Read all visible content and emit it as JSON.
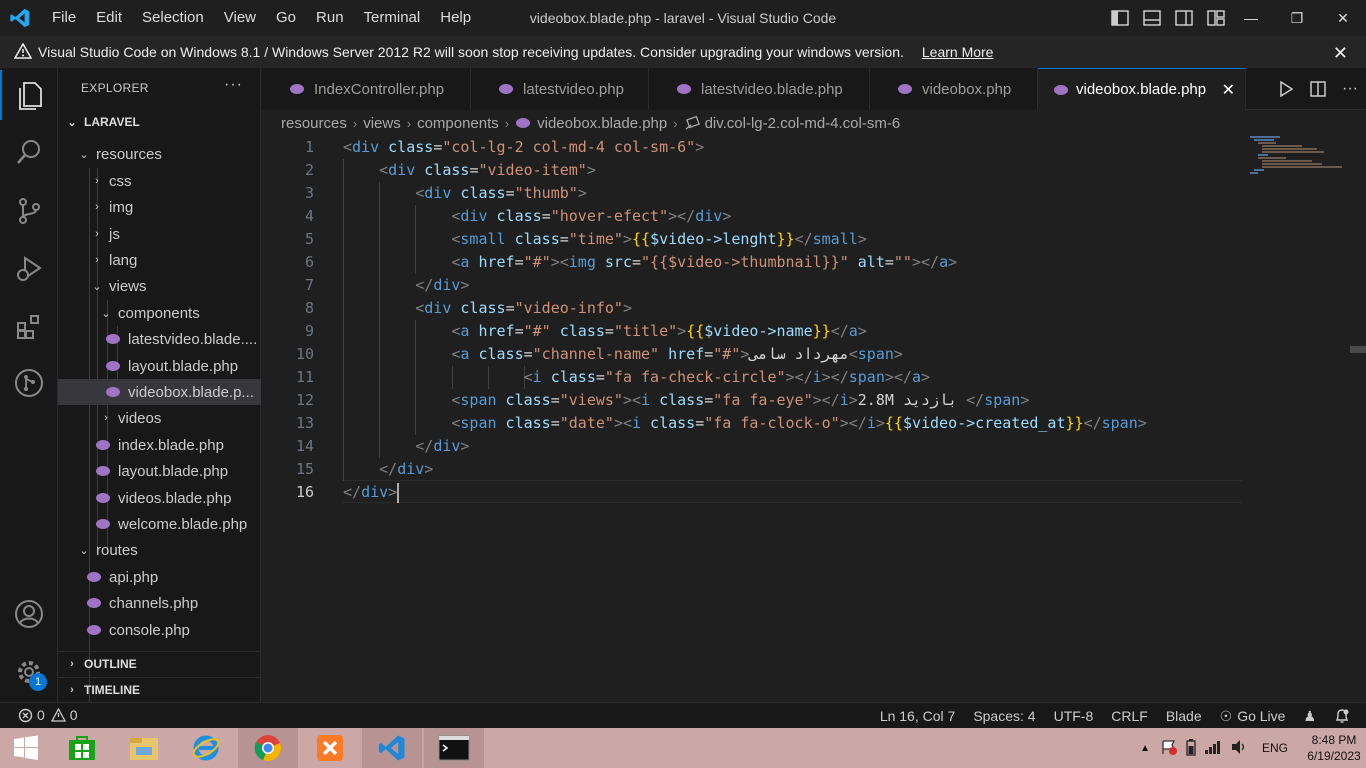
{
  "titlebar": {
    "menu": [
      "File",
      "Edit",
      "Selection",
      "View",
      "Go",
      "Run",
      "Terminal",
      "Help"
    ],
    "title": "videobox.blade.php - laravel - Visual Studio Code"
  },
  "banner": {
    "message": "Visual Studio Code on Windows 8.1 / Windows Server 2012 R2 will soon stop receiving updates. Consider upgrading your windows version.",
    "link": "Learn More"
  },
  "sidebar": {
    "header": "EXPLORER",
    "workspace": "LARAVEL",
    "tree": [
      {
        "label": "resources",
        "kind": "folder",
        "open": true
      },
      {
        "label": "css",
        "kind": "folder",
        "open": false
      },
      {
        "label": "img",
        "kind": "folder",
        "open": false
      },
      {
        "label": "js",
        "kind": "folder",
        "open": false
      },
      {
        "label": "lang",
        "kind": "folder",
        "open": false
      },
      {
        "label": "views",
        "kind": "folder",
        "open": true
      },
      {
        "label": "components",
        "kind": "folder",
        "open": true
      },
      {
        "label": "latestvideo.blade....",
        "kind": "file"
      },
      {
        "label": "layout.blade.php",
        "kind": "file"
      },
      {
        "label": "videobox.blade.p...",
        "kind": "file",
        "selected": true
      },
      {
        "label": "videos",
        "kind": "folder",
        "open": false
      },
      {
        "label": "index.blade.php",
        "kind": "file"
      },
      {
        "label": "layout.blade.php",
        "kind": "file"
      },
      {
        "label": "videos.blade.php",
        "kind": "file"
      },
      {
        "label": "welcome.blade.php",
        "kind": "file"
      },
      {
        "label": "routes",
        "kind": "folder",
        "open": true
      },
      {
        "label": "api.php",
        "kind": "file"
      },
      {
        "label": "channels.php",
        "kind": "file"
      },
      {
        "label": "console.php",
        "kind": "file"
      }
    ],
    "outline": "OUTLINE",
    "timeline": "TIMELINE",
    "settings_badge": "1"
  },
  "tabs": [
    {
      "label": "IndexController.php",
      "active": false
    },
    {
      "label": "latestvideo.php",
      "active": false
    },
    {
      "label": "latestvideo.blade.php",
      "active": false
    },
    {
      "label": "videobox.php",
      "active": false
    },
    {
      "label": "videobox.blade.php",
      "active": true
    }
  ],
  "breadcrumb": [
    "resources",
    "views",
    "components",
    "videobox.blade.php",
    "div.col-lg-2.col-md-4.col-sm-6"
  ],
  "editor": {
    "line_numbers": [
      "1",
      "2",
      "3",
      "4",
      "5",
      "6",
      "7",
      "8",
      "9",
      "10",
      "11",
      "12",
      "13",
      "14",
      "15",
      "16"
    ],
    "current_line": 16,
    "lines": [
      "<div class=\"col-lg-2 col-md-4 col-sm-6\">",
      "    <div class=\"video-item\">",
      "        <div class=\"thumb\">",
      "            <div class=\"hover-efect\"></div>",
      "            <small class=\"time\">{{$video->lenght}}</small>",
      "            <a href=\"#\"><img src=\"{{$video->thumbnail}}\" alt=\"\"></a>",
      "        </div>",
      "        <div class=\"video-info\">",
      "            <a href=\"#\" class=\"title\">{{$video->name}}</a>",
      "            <a class=\"channel-name\" href=\"#\">مهرداد سامی<span>",
      "                    <i class=\"fa fa-check-circle\"></i></span></a>",
      "            <span class=\"views\"><i class=\"fa fa-eye\"></i>2.8M بازدید </span>",
      "            <span class=\"date\"><i class=\"fa fa-clock-o\"></i>{{$video->created_at}}</span>",
      "        </div>",
      "    </div>",
      "</div>"
    ]
  },
  "statusbar": {
    "errors": "0",
    "warnings": "0",
    "position": "Ln 16, Col 7",
    "spaces": "Spaces: 4",
    "encoding": "UTF-8",
    "eol": "CRLF",
    "language": "Blade",
    "golive": "Go Live"
  },
  "taskbar": {
    "lang": "ENG",
    "time": "8:48 PM",
    "date": "6/19/2023"
  },
  "colors": {
    "accent": "#0078d4",
    "taskbar": "#cba7a6",
    "php_icon": "#a074c4"
  }
}
